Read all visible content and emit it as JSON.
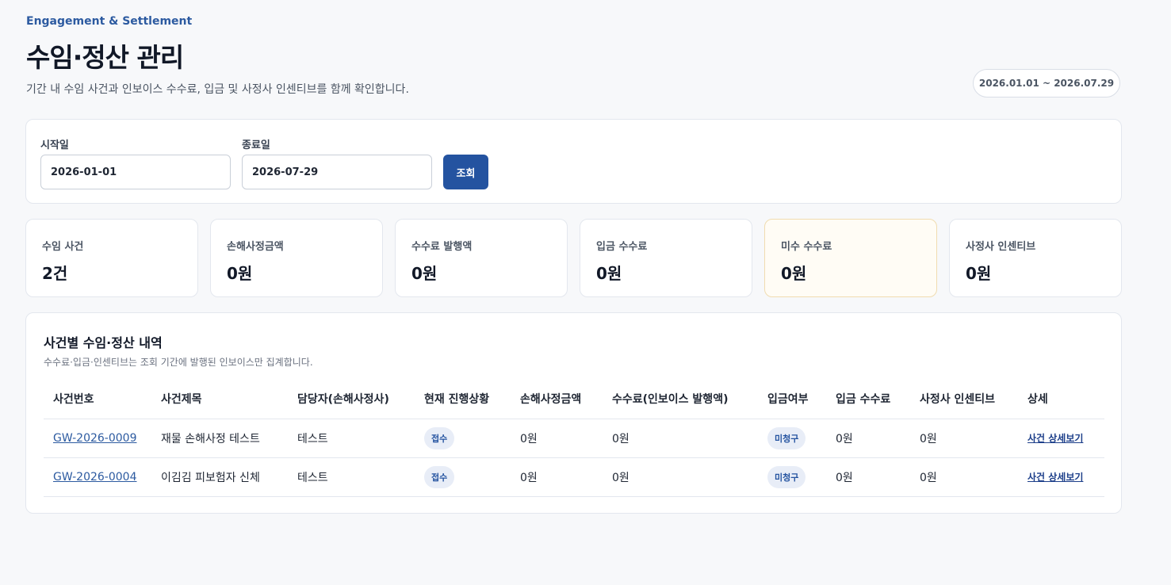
{
  "header": {
    "eyebrow": "Engagement & Settlement",
    "title": "수임·정산 관리",
    "description": "기간 내 수임 사건과 인보이스 수수료, 입금 및 사정사 인센티브를 함께 확인합니다.",
    "period": "2026.01.01 ~ 2026.07.29"
  },
  "filter": {
    "start_label": "시작일",
    "start_value": "2026-01-01",
    "end_label": "종료일",
    "end_value": "2026-07-29",
    "search_label": "조회"
  },
  "stats": [
    {
      "label": "수임 사건",
      "value": "2건"
    },
    {
      "label": "손해사정금액",
      "value": "0원"
    },
    {
      "label": "수수료 발행액",
      "value": "0원"
    },
    {
      "label": "입금 수수료",
      "value": "0원"
    },
    {
      "label": "미수 수수료",
      "value": "0원"
    },
    {
      "label": "사정사 인센티브",
      "value": "0원"
    }
  ],
  "table": {
    "title": "사건별 수임·정산 내역",
    "note": "수수료·입금·인센티브는 조회 기간에 발행된 인보이스만 집계합니다.",
    "columns": [
      "사건번호",
      "사건제목",
      "담당자(손해사정사)",
      "현재 진행상황",
      "손해사정금액",
      "수수료(인보이스 발행액)",
      "입금여부",
      "입금 수수료",
      "사정사 인센티브",
      "상세"
    ],
    "rows": [
      {
        "case_no": "GW-2026-0009",
        "title": "재물 손해사정 테스트",
        "manager": "테스트",
        "status": "접수",
        "adjust_amount": "0원",
        "fee": "0원",
        "paid": "미청구",
        "paid_fee": "0원",
        "incentive": "0원",
        "detail": "사건 상세보기"
      },
      {
        "case_no": "GW-2026-0004",
        "title": "이김김 피보험자 신체",
        "manager": "테스트",
        "status": "접수",
        "adjust_amount": "0원",
        "fee": "0원",
        "paid": "미청구",
        "paid_fee": "0원",
        "incentive": "0원",
        "detail": "사건 상세보기"
      }
    ]
  }
}
